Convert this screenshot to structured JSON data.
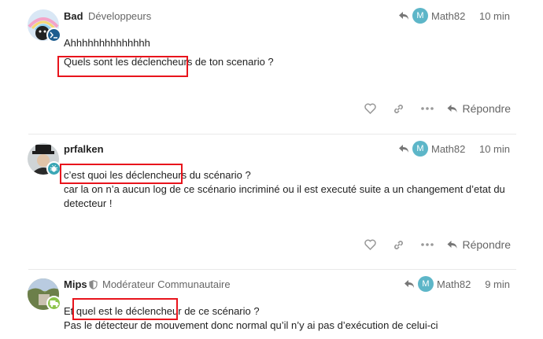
{
  "colors": {
    "accent": "#5db6c8",
    "highlight": "#e8141c",
    "muted": "#666666"
  },
  "posts": [
    {
      "username": "Bad",
      "user_title": "Développeurs",
      "reply_to_user": "Math82",
      "reply_to_initial": "M",
      "time": "10 min",
      "lines": [
        "Ahhhhhhhhhhhhhh",
        "Quels sont les déclencheurs de ton scenario ?"
      ],
      "reply_label": "Répondre",
      "flair_icon": "terminal-icon"
    },
    {
      "username": "prfalken",
      "user_title": "",
      "reply_to_user": "Math82",
      "reply_to_initial": "M",
      "time": "10 min",
      "lines": [
        "c’est quoi les déclencheurs du scénario ?",
        "car la on n’a aucun log de ce scénario incriminé ou il est executé suite a un changement d’etat du",
        "detecteur !"
      ],
      "reply_label": "Répondre",
      "flair_icon": "bug-icon"
    },
    {
      "username": "Mips",
      "user_title": "Modérateur Communautaire",
      "reply_to_user": "Math82",
      "reply_to_initial": "M",
      "time": "9 min",
      "lines": [
        "Et quel est le déclencheur de ce scénario ?",
        "Pas le détecteur de mouvement donc normal qu’il n’y ai pas d’exécution de celui-ci"
      ],
      "flair_icon": "truck-icon"
    }
  ]
}
